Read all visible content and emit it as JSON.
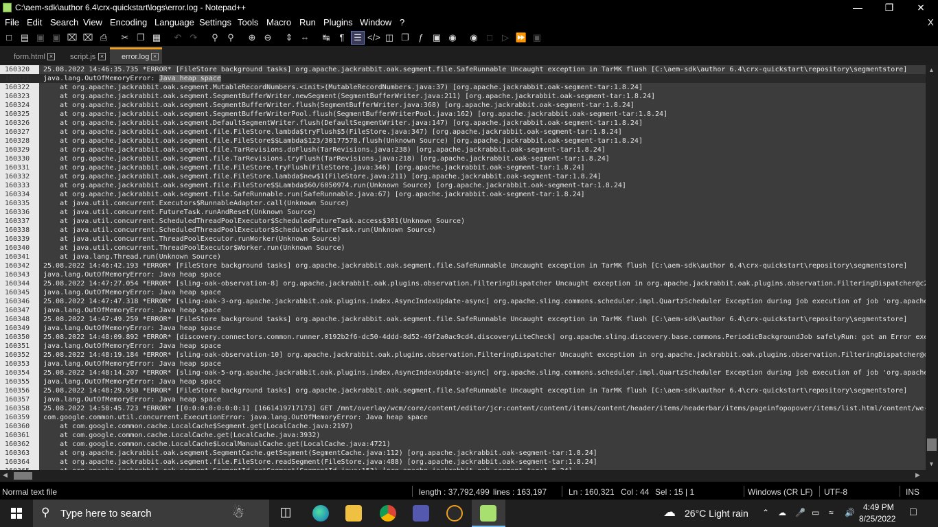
{
  "window": {
    "title": "C:\\aem-sdk\\author 6.4\\crx-quickstart\\logs\\error.log - Notepad++",
    "minimize": "—",
    "restore": "❐",
    "close": "✕"
  },
  "menu": [
    "File",
    "Edit",
    "Search",
    "View",
    "Encoding",
    "Language",
    "Settings",
    "Tools",
    "Macro",
    "Run",
    "Plugins",
    "Window",
    "?"
  ],
  "menu_close": "X",
  "tabs": [
    {
      "label": "form.html",
      "active": false
    },
    {
      "label": "script.js",
      "active": false
    },
    {
      "label": "error.log",
      "active": true
    }
  ],
  "tab_close": "×",
  "editor": {
    "lines": [
      {
        "n": "160320",
        "t": "25.08.2022 14:46:35.735 *ERROR* [FileStore background tasks] org.apache.jackrabbit.oak.segment.file.SafeRunnable Uncaught exception in TarMK flush [C:\\aem-sdk\\author 6.4\\crx-quickstart\\repository\\segmentstore]"
      },
      {
        "n": "160321",
        "t": "java.lang.OutOfMemoryError: ",
        "s": "Java heap space"
      },
      {
        "n": "160322",
        "t": "    at org.apache.jackrabbit.oak.segment.MutableRecordNumbers.<init>(MutableRecordNumbers.java:37) [org.apache.jackrabbit.oak-segment-tar:1.8.24]"
      },
      {
        "n": "160323",
        "t": "    at org.apache.jackrabbit.oak.segment.SegmentBufferWriter.newSegment(SegmentBufferWriter.java:211) [org.apache.jackrabbit.oak-segment-tar:1.8.24]"
      },
      {
        "n": "160324",
        "t": "    at org.apache.jackrabbit.oak.segment.SegmentBufferWriter.flush(SegmentBufferWriter.java:368) [org.apache.jackrabbit.oak-segment-tar:1.8.24]"
      },
      {
        "n": "160325",
        "t": "    at org.apache.jackrabbit.oak.segment.SegmentBufferWriterPool.flush(SegmentBufferWriterPool.java:162) [org.apache.jackrabbit.oak-segment-tar:1.8.24]"
      },
      {
        "n": "160326",
        "t": "    at org.apache.jackrabbit.oak.segment.DefaultSegmentWriter.flush(DefaultSegmentWriter.java:147) [org.apache.jackrabbit.oak-segment-tar:1.8.24]"
      },
      {
        "n": "160327",
        "t": "    at org.apache.jackrabbit.oak.segment.file.FileStore.lambda$tryFlush$5(FileStore.java:347) [org.apache.jackrabbit.oak-segment-tar:1.8.24]"
      },
      {
        "n": "160328",
        "t": "    at org.apache.jackrabbit.oak.segment.file.FileStore$$Lambda$123/30177578.flush(Unknown Source) [org.apache.jackrabbit.oak-segment-tar:1.8.24]"
      },
      {
        "n": "160329",
        "t": "    at org.apache.jackrabbit.oak.segment.file.TarRevisions.doFlush(TarRevisions.java:238) [org.apache.jackrabbit.oak-segment-tar:1.8.24]"
      },
      {
        "n": "160330",
        "t": "    at org.apache.jackrabbit.oak.segment.file.TarRevisions.tryFlush(TarRevisions.java:218) [org.apache.jackrabbit.oak-segment-tar:1.8.24]"
      },
      {
        "n": "160331",
        "t": "    at org.apache.jackrabbit.oak.segment.file.FileStore.tryFlush(FileStore.java:346) [org.apache.jackrabbit.oak-segment-tar:1.8.24]"
      },
      {
        "n": "160332",
        "t": "    at org.apache.jackrabbit.oak.segment.file.FileStore.lambda$new$1(FileStore.java:211) [org.apache.jackrabbit.oak-segment-tar:1.8.24]"
      },
      {
        "n": "160333",
        "t": "    at org.apache.jackrabbit.oak.segment.file.FileStore$$Lambda$60/6050974.run(Unknown Source) [org.apache.jackrabbit.oak-segment-tar:1.8.24]"
      },
      {
        "n": "160334",
        "t": "    at org.apache.jackrabbit.oak.segment.file.SafeRunnable.run(SafeRunnable.java:67) [org.apache.jackrabbit.oak-segment-tar:1.8.24]"
      },
      {
        "n": "160335",
        "t": "    at java.util.concurrent.Executors$RunnableAdapter.call(Unknown Source)"
      },
      {
        "n": "160336",
        "t": "    at java.util.concurrent.FutureTask.runAndReset(Unknown Source)"
      },
      {
        "n": "160337",
        "t": "    at java.util.concurrent.ScheduledThreadPoolExecutor$ScheduledFutureTask.access$301(Unknown Source)"
      },
      {
        "n": "160338",
        "t": "    at java.util.concurrent.ScheduledThreadPoolExecutor$ScheduledFutureTask.run(Unknown Source)"
      },
      {
        "n": "160339",
        "t": "    at java.util.concurrent.ThreadPoolExecutor.runWorker(Unknown Source)"
      },
      {
        "n": "160340",
        "t": "    at java.util.concurrent.ThreadPoolExecutor$Worker.run(Unknown Source)"
      },
      {
        "n": "160341",
        "t": "    at java.lang.Thread.run(Unknown Source)"
      },
      {
        "n": "160342",
        "t": "25.08.2022 14:46:42.193 *ERROR* [FileStore background tasks] org.apache.jackrabbit.oak.segment.file.SafeRunnable Uncaught exception in TarMK flush [C:\\aem-sdk\\author 6.4\\crx-quickstart\\repository\\segmentstore]"
      },
      {
        "n": "160343",
        "t": "java.lang.OutOfMemoryError: Java heap space"
      },
      {
        "n": "160344",
        "t": "25.08.2022 14:47:27.054 *ERROR* [sling-oak-observation-8] org.apache.jackrabbit.oak.plugins.observation.FilteringDispatcher Uncaught exception in org.apache.jackrabbit.oak.plugins.observation.FilteringDispatcher@c2"
      },
      {
        "n": "160345",
        "t": "java.lang.OutOfMemoryError: Java heap space"
      },
      {
        "n": "160346",
        "t": "25.08.2022 14:47:47.318 *ERROR* [sling-oak-3-org.apache.jackrabbit.oak.plugins.index.AsyncIndexUpdate-async] org.apache.sling.commons.scheduler.impl.QuartzScheduler Exception during job execution of job 'org.apache"
      },
      {
        "n": "160347",
        "t": "java.lang.OutOfMemoryError: Java heap space"
      },
      {
        "n": "160348",
        "t": "25.08.2022 14:47:49.259 *ERROR* [FileStore background tasks] org.apache.jackrabbit.oak.segment.file.SafeRunnable Uncaught exception in TarMK flush [C:\\aem-sdk\\author 6.4\\crx-quickstart\\repository\\segmentstore]"
      },
      {
        "n": "160349",
        "t": "java.lang.OutOfMemoryError: Java heap space"
      },
      {
        "n": "160350",
        "t": "25.08.2022 14:48:09.892 *ERROR* [discovery.connectors.common.runner.0192b2f6-dc50-4ddd-8d52-49f2a0ac9cd4.discoveryLiteCheck] org.apache.sling.discovery.base.commons.PeriodicBackgroundJob safelyRun: got an Error exe"
      },
      {
        "n": "160351",
        "t": "java.lang.OutOfMemoryError: Java heap space"
      },
      {
        "n": "160352",
        "t": "25.08.2022 14:48:19.184 *ERROR* [sling-oak-observation-10] org.apache.jackrabbit.oak.plugins.observation.FilteringDispatcher Uncaught exception in org.apache.jackrabbit.oak.plugins.observation.FilteringDispatcher@c"
      },
      {
        "n": "160353",
        "t": "java.lang.OutOfMemoryError: Java heap space"
      },
      {
        "n": "160354",
        "t": "25.08.2022 14:48:14.207 *ERROR* [sling-oak-5-org.apache.jackrabbit.oak.plugins.index.AsyncIndexUpdate-async] org.apache.sling.commons.scheduler.impl.QuartzScheduler Exception during job execution of job 'org.apache"
      },
      {
        "n": "160355",
        "t": "java.lang.OutOfMemoryError: Java heap space"
      },
      {
        "n": "160356",
        "t": "25.08.2022 14:48:29.930 *ERROR* [FileStore background tasks] org.apache.jackrabbit.oak.segment.file.SafeRunnable Uncaught exception in TarMK flush [C:\\aem-sdk\\author 6.4\\crx-quickstart\\repository\\segmentstore]"
      },
      {
        "n": "160357",
        "t": "java.lang.OutOfMemoryError: Java heap space"
      },
      {
        "n": "160358",
        "t": "25.08.2022 14:58:45.723 *ERROR* [[0:0:0:0:0:0:0:1] [1661419717173] GET /mnt/overlay/wcm/core/content/editor/jcr:content/content/items/content/header/items/headerbar/items/pageinfopopover/items/list.html/content/we-"
      },
      {
        "n": "160359",
        "t": "com.google.common.util.concurrent.ExecutionError: java.lang.OutOfMemoryError: Java heap space"
      },
      {
        "n": "160360",
        "t": "    at com.google.common.cache.LocalCache$Segment.get(LocalCache.java:2197)"
      },
      {
        "n": "160361",
        "t": "    at com.google.common.cache.LocalCache.get(LocalCache.java:3932)"
      },
      {
        "n": "160362",
        "t": "    at com.google.common.cache.LocalCache$LocalManualCache.get(LocalCache.java:4721)"
      },
      {
        "n": "160363",
        "t": "    at org.apache.jackrabbit.oak.segment.SegmentCache.getSegment(SegmentCache.java:112) [org.apache.jackrabbit.oak-segment-tar:1.8.24]"
      },
      {
        "n": "160364",
        "t": "    at org.apache.jackrabbit.oak.segment.file.FileStore.readSegment(FileStore.java:488) [org.apache.jackrabbit.oak-segment-tar:1.8.24]"
      },
      {
        "n": "160365",
        "t": "    at org.apache.jackrabbit.oak.segment.SegmentId.getSegment(SegmentId.java:153) [org.apache.jackrabbit.oak-segment-tar:1.8.24]"
      }
    ]
  },
  "status": {
    "file_type": "Normal text file",
    "length": "length : 37,792,499",
    "lines": "lines : 163,197",
    "ln": "Ln : 160,321",
    "col": "Col : 44",
    "sel": "Sel : 15 | 1",
    "eol": "Windows (CR LF)",
    "encoding": "UTF-8",
    "mode": "INS"
  },
  "taskbar": {
    "search_placeholder": "Type here to search",
    "weather": "26°C  Light rain",
    "time": "4:49 PM",
    "date": "8/25/2022"
  },
  "colors": {
    "accent": "#f0a020",
    "editor_bg": "#3c3c3c",
    "text": "#e6e6e6"
  }
}
